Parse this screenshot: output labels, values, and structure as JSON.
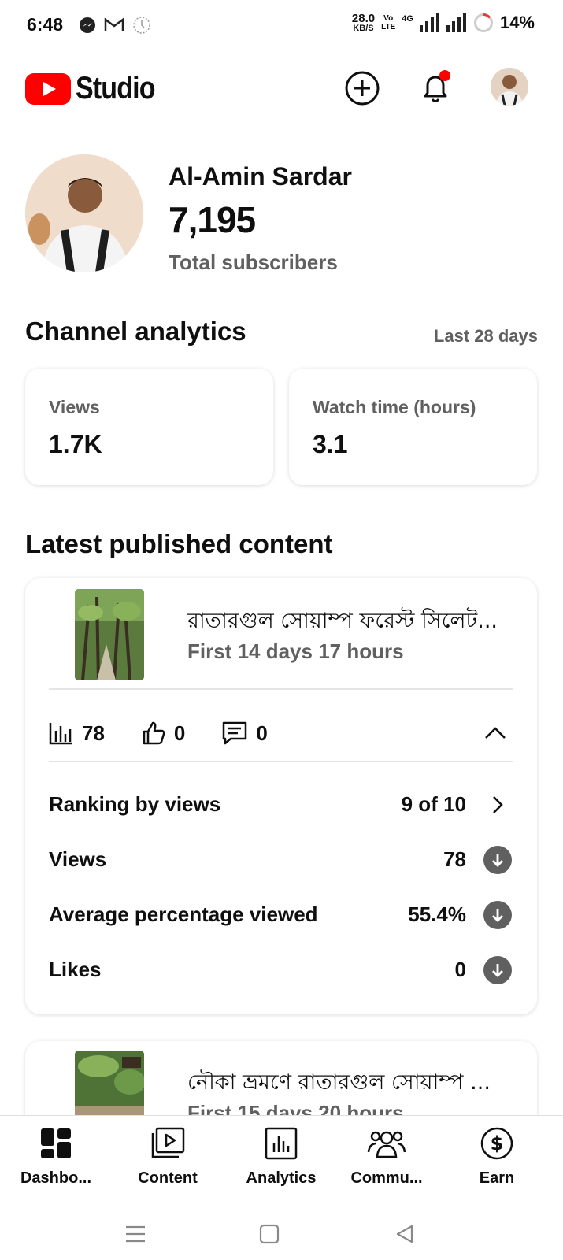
{
  "status_bar": {
    "time": "6:48",
    "net_speed": "28.0",
    "net_unit": "KB/S",
    "volte_top": "Vo",
    "volte_bottom": "LTE",
    "network_type": "4G",
    "battery": "14%"
  },
  "app": {
    "logo_text": "Studio",
    "brand_color": "#ff0000"
  },
  "profile": {
    "name": "Al-Amin Sardar",
    "subscribers": "7,195",
    "subscribers_label": "Total subscribers"
  },
  "analytics": {
    "title": "Channel analytics",
    "range": "Last 28 days",
    "cards": [
      {
        "label": "Views",
        "value": "1.7K"
      },
      {
        "label": "Watch time (hours)",
        "value": "3.1"
      }
    ]
  },
  "latest": {
    "title": "Latest published content",
    "video": {
      "title": "রাতারগুল সোয়াম্প ফরেস্ট সিলেট...",
      "subtitle": "First 14 days 17 hours",
      "views": "78",
      "likes": "0",
      "comments": "0",
      "rows": [
        {
          "label": "Ranking by views",
          "value": "9 of 10",
          "icon": "chevron-right-icon"
        },
        {
          "label": "Views",
          "value": "78",
          "icon": "arrow-down-icon"
        },
        {
          "label": "Average percentage viewed",
          "value": "55.4%",
          "icon": "arrow-down-icon"
        },
        {
          "label": "Likes",
          "value": "0",
          "icon": "arrow-down-icon"
        }
      ]
    },
    "video2": {
      "title": "নৌকা ভ্রমণে রাতারগুল সোয়াম্প ...",
      "subtitle": "First 15 days 20 hours"
    }
  },
  "nav": [
    {
      "label": "Dashbo...",
      "icon": "dashboard-icon"
    },
    {
      "label": "Content",
      "icon": "content-icon"
    },
    {
      "label": "Analytics",
      "icon": "analytics-icon"
    },
    {
      "label": "Commu...",
      "icon": "community-icon"
    },
    {
      "label": "Earn",
      "icon": "earn-icon"
    }
  ]
}
